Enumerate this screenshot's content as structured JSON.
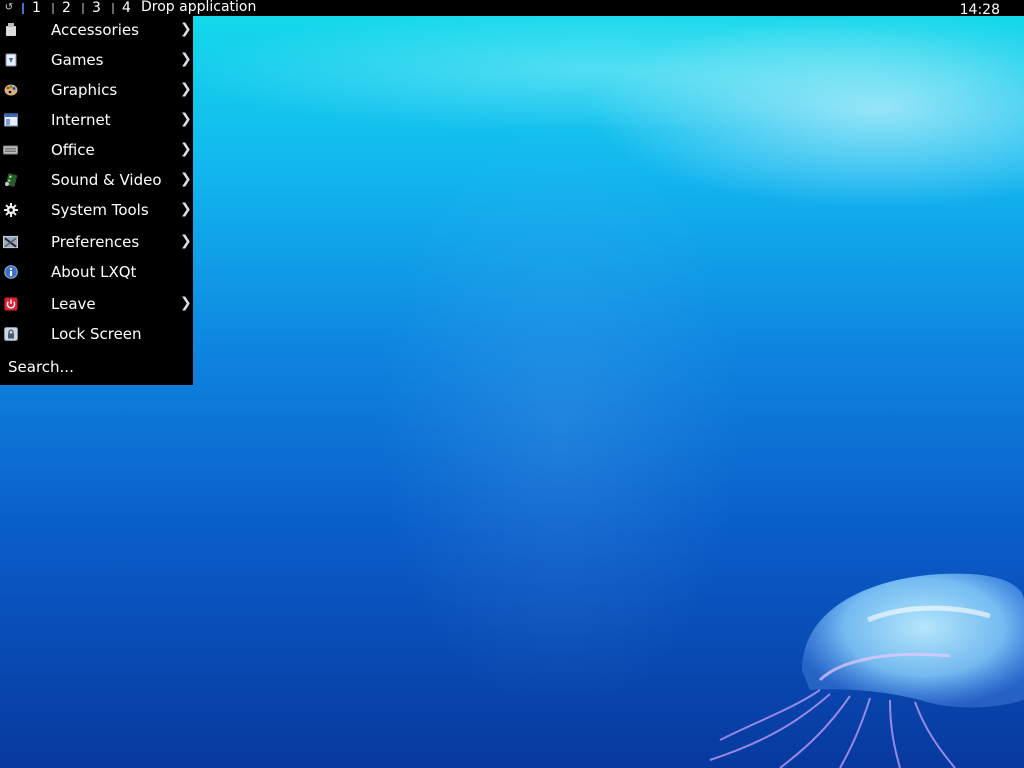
{
  "panel": {
    "menu_icon": "lxqt-logo-icon",
    "desktops": [
      "1",
      "2",
      "3",
      "4"
    ],
    "active_desktop": "1",
    "drop_text": "Drop application",
    "clock": "14:28"
  },
  "menu": {
    "items": [
      {
        "label": "Accessories",
        "icon": "accessories-icon",
        "submenu": true
      },
      {
        "label": "Games",
        "icon": "games-icon",
        "submenu": true
      },
      {
        "label": "Graphics",
        "icon": "graphics-palette-icon",
        "submenu": true
      },
      {
        "label": "Internet",
        "icon": "internet-icon",
        "submenu": true
      },
      {
        "label": "Office",
        "icon": "office-icon",
        "submenu": true
      },
      {
        "label": "Sound & Video",
        "icon": "multimedia-icon",
        "submenu": true
      },
      {
        "label": "System Tools",
        "icon": "gear-icon",
        "submenu": true
      },
      {
        "label": "Preferences",
        "icon": "preferences-icon",
        "submenu": true
      },
      {
        "label": "About LXQt",
        "icon": "info-icon",
        "submenu": false
      },
      {
        "label": "Leave",
        "icon": "power-icon",
        "submenu": true
      },
      {
        "label": "Lock Screen",
        "icon": "lock-icon",
        "submenu": false
      }
    ],
    "arrow_glyph": "❯",
    "search_text": "Search..."
  },
  "colors": {
    "panel_bg": "#000000",
    "menu_bg": "#000000",
    "active_desktop_bar": "#3d74c9",
    "desktop_top": "#14dcea",
    "desktop_bottom": "#07399e"
  }
}
